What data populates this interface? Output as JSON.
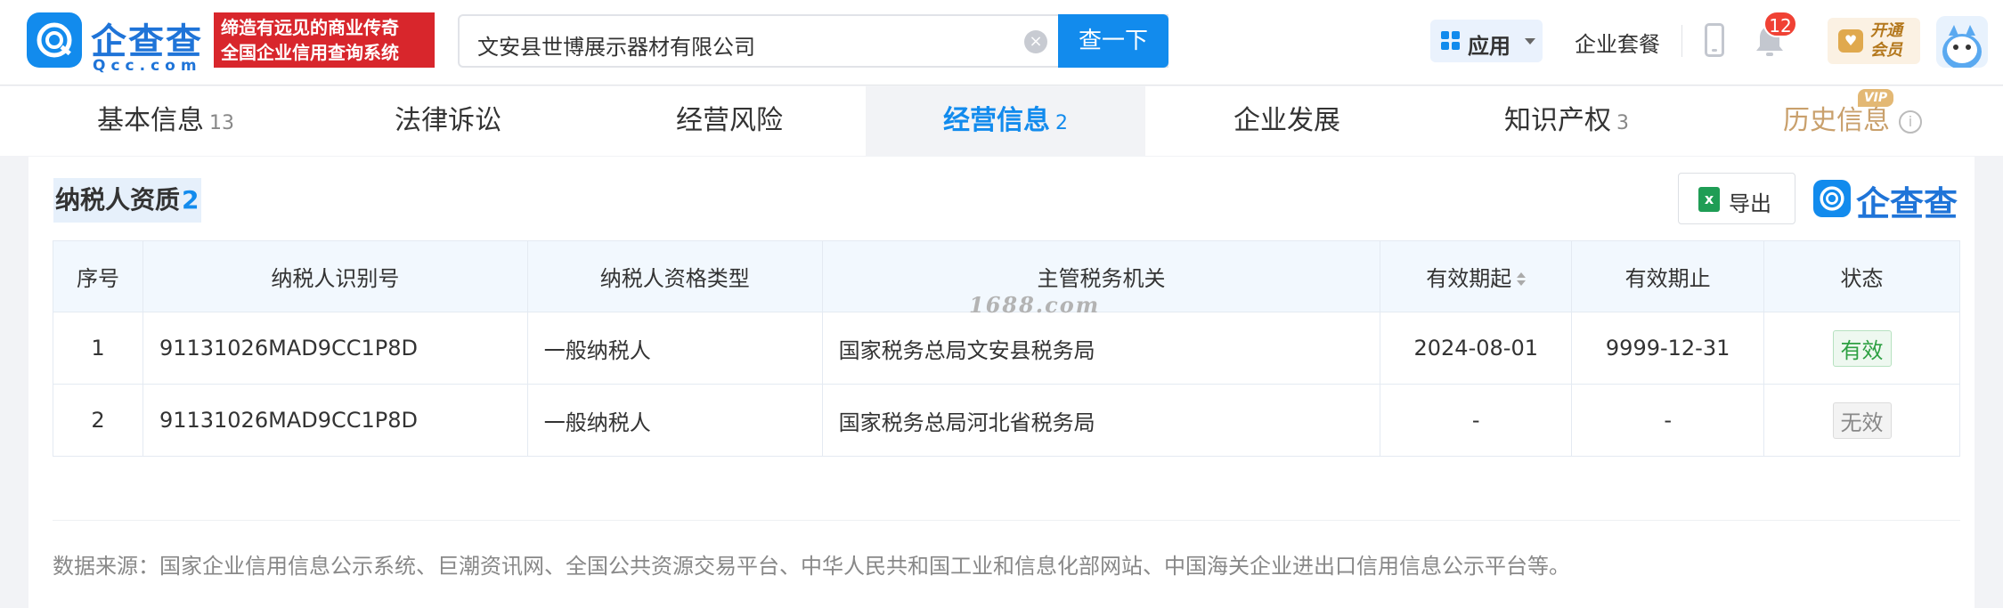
{
  "header": {
    "logo_cn": "企查查",
    "logo_en": "Qcc.com",
    "slogan_line1": "缔造有远见的商业传奇",
    "slogan_line2": "全国企业信用查询系统",
    "search_value": "文安县世博展示器材有限公司",
    "search_button": "查一下",
    "app_label": "应用",
    "package_link": "企业套餐",
    "notification_count": "12",
    "vip_line1": "开通",
    "vip_line2": "会员"
  },
  "tabs": [
    {
      "label": "基本信息",
      "count": "13"
    },
    {
      "label": "法律诉讼",
      "count": ""
    },
    {
      "label": "经营风险",
      "count": ""
    },
    {
      "label": "经营信息",
      "count": "2"
    },
    {
      "label": "企业发展",
      "count": ""
    },
    {
      "label": "知识产权",
      "count": "3"
    },
    {
      "label": "历史信息",
      "count": ""
    }
  ],
  "vip_flag": "VIP",
  "section": {
    "title": "纳税人资质",
    "count": "2",
    "export_label": "导出",
    "brand": "企查查"
  },
  "table": {
    "headers": [
      "序号",
      "纳税人识别号",
      "纳税人资格类型",
      "主管税务机关",
      "有效期起",
      "有效期止",
      "状态"
    ],
    "rows": [
      [
        "1",
        "91131026MAD9CC1P8D",
        "一般纳税人",
        "国家税务总局文安县税务局",
        "2024-08-01",
        "9999-12-31",
        "有效"
      ],
      [
        "2",
        "91131026MAD9CC1P8D",
        "一般纳税人",
        "国家税务总局河北省税务局",
        "-",
        "-",
        "无效"
      ]
    ]
  },
  "watermark": "1688.com",
  "source_note": "数据来源：国家企业信用信息公示系统、巨潮资讯网、全国公共资源交易平台、中华人民共和国工业和信息化部网站、中国海关企业进出口信用信息公示平台等。",
  "colors": {
    "brand_blue": "#128bed",
    "slogan_red": "#d8262c",
    "valid_green": "#2ea043",
    "vip_gold": "#c9a06c"
  }
}
